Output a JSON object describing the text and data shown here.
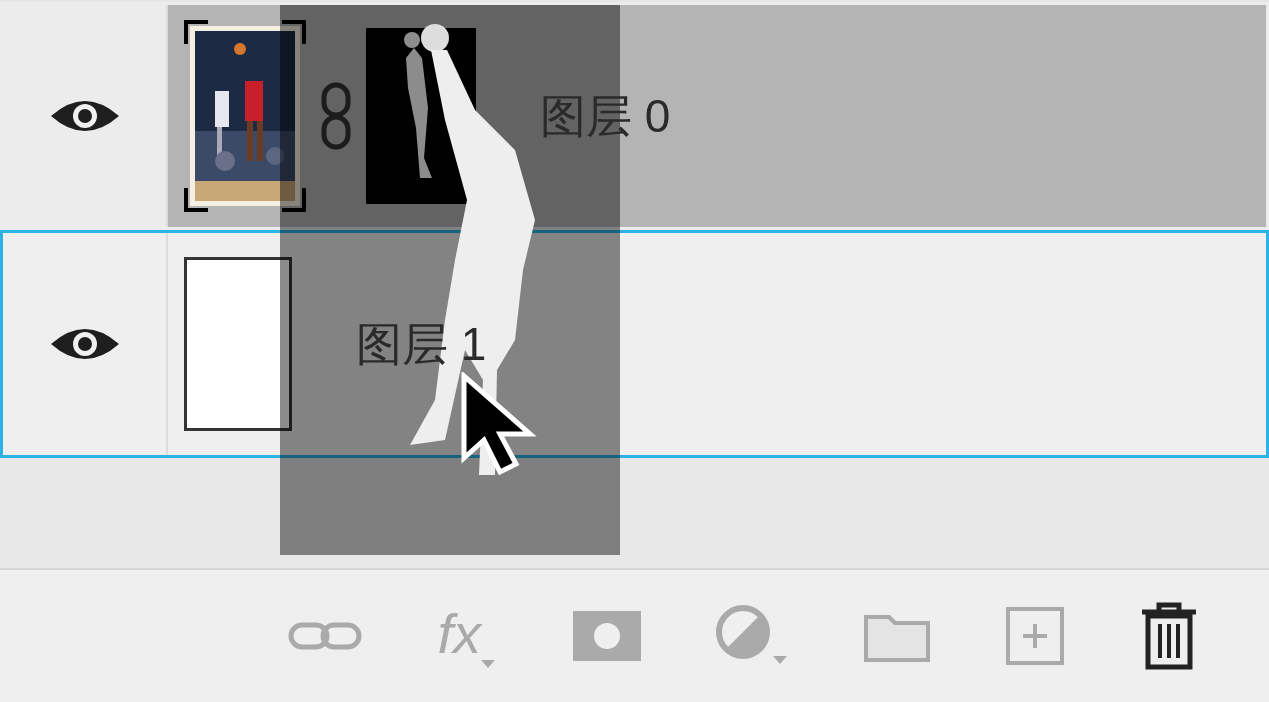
{
  "layers": [
    {
      "name": "图层 0",
      "visible": true,
      "selected": false,
      "highlighted": true,
      "mask": true
    },
    {
      "name": "图层 1",
      "visible": true,
      "selected": true,
      "highlighted": false,
      "mask": false,
      "kind": "fill"
    }
  ],
  "toolbar": {
    "fx_label": "fx"
  },
  "drag_preview": {
    "visible": true
  }
}
